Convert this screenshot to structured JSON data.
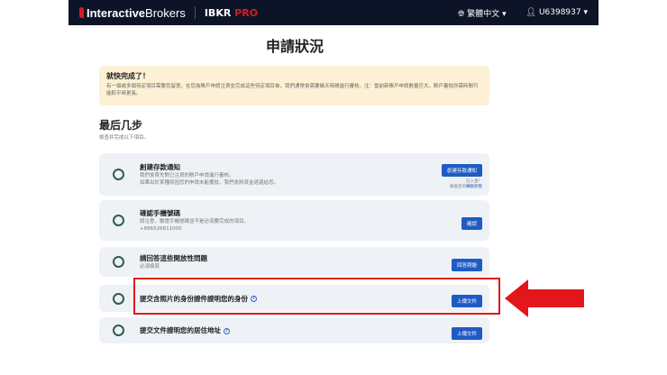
{
  "header": {
    "logo_bold": "Interactive",
    "logo_light": "Brokers",
    "product": "IBKR",
    "product_accent": "PRO",
    "language": "繁體中文",
    "user": "U6398937"
  },
  "page_title": "申請狀況",
  "notice": {
    "title": "就快完成了！",
    "text": "有一個或多個待定項目需要您留意。在您為賬戶申請注資並完成這些待定項目後，我們通常會需要幾天時間進行審核。注：當前新賬戶申請數量巨大，賬戶審批所需時間可能較平時更長。"
  },
  "steps": {
    "heading": "最后几步",
    "subheading": "檢查并完成以下項目。",
    "items": [
      {
        "title": "創建存款通知",
        "lines": [
          "我們會首先對已注資的賬戶申請進行審核。",
          "如果出於某種原因您的申請未能獲批，我們會將資金退還給您。"
        ],
        "button": "創建存款通知",
        "note1": "已入金？",
        "note2_prefix": "檢查您的",
        "note2_link": "轉帳狀態"
      },
      {
        "title": "確認手機號碼",
        "lines": [
          "請注意，驗證手機號碼並不是必須要完成的項目。",
          "+886526811000"
        ],
        "button": "確認"
      },
      {
        "title": "請回答這些開放性問題",
        "lines": [
          "必須填寫"
        ],
        "button": "回答問題"
      },
      {
        "title": "提交含照片的身份證件證明您的身份",
        "button": "上傳文件"
      },
      {
        "title": "提交文件證明您的居住地址",
        "button": "上傳文件"
      }
    ]
  },
  "colors": {
    "highlight": "#e3171b",
    "button": "#1f5bc4"
  }
}
